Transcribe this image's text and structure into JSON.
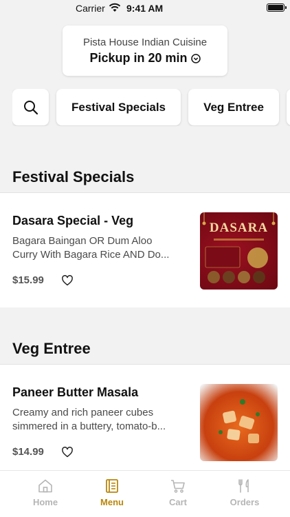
{
  "status_bar": {
    "carrier": "Carrier",
    "time": "9:41 AM"
  },
  "pickup": {
    "restaurant": "Pista House Indian Cuisine",
    "label": "Pickup in 20 min"
  },
  "categories": [
    "Festival Specials",
    "Veg Entree"
  ],
  "sections": [
    {
      "title": "Festival Specials",
      "items": [
        {
          "name": "Dasara Special - Veg",
          "description_lines": [
            "Bagara Baingan OR Dum Aloo",
            "Curry With Bagara Rice AND Do..."
          ],
          "price": "$15.99",
          "image_text": "DASARA"
        }
      ]
    },
    {
      "title": "Veg Entree",
      "items": [
        {
          "name": "Paneer Butter Masala",
          "description_lines": [
            "Creamy and rich paneer cubes",
            "simmered in a buttery, tomato-b..."
          ],
          "price": "$14.99"
        }
      ]
    }
  ],
  "tabs": [
    {
      "label": "Home",
      "icon": "home-icon",
      "active": false
    },
    {
      "label": "Menu",
      "icon": "menu-book-icon",
      "active": true
    },
    {
      "label": "Cart",
      "icon": "cart-icon",
      "active": false
    },
    {
      "label": "Orders",
      "icon": "fork-knife-icon",
      "active": false
    }
  ],
  "colors": {
    "accent": "#b8860b",
    "background": "#f2f2f2",
    "inactive_tab": "#b5b5b5"
  }
}
